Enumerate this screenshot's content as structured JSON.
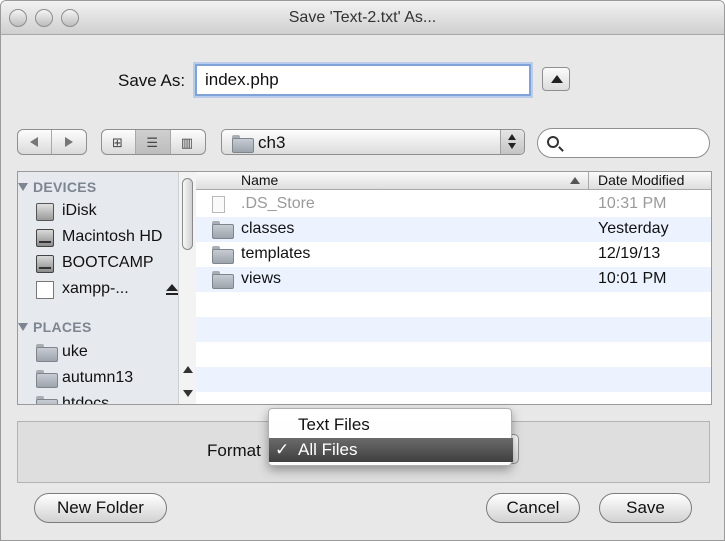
{
  "window": {
    "title": "Save 'Text-2.txt' As..."
  },
  "save_as": {
    "label": "Save As:",
    "value": "index.php"
  },
  "toolbar": {
    "path_label": "ch3",
    "search_value": ""
  },
  "sidebar": {
    "devices_header": "DEVICES",
    "devices": [
      {
        "label": "iDisk",
        "icon": "idisk-icon"
      },
      {
        "label": "Macintosh HD",
        "icon": "hard-drive-icon"
      },
      {
        "label": "BOOTCAMP",
        "icon": "hard-drive-icon"
      },
      {
        "label": "xampp-...",
        "icon": "volume-icon"
      }
    ],
    "places_header": "PLACES",
    "places": [
      {
        "label": "uke",
        "icon": "folder-icon"
      },
      {
        "label": "autumn13",
        "icon": "folder-icon"
      },
      {
        "label": "htdocs",
        "icon": "folder-icon"
      }
    ]
  },
  "file_list": {
    "columns": [
      "Name",
      "Date Modified"
    ],
    "rows": [
      {
        "name": ".DS_Store",
        "date": "10:31 PM",
        "icon": "document-icon",
        "dimmed": true
      },
      {
        "name": "classes",
        "date": "Yesterday",
        "icon": "folder-icon",
        "dimmed": false
      },
      {
        "name": "templates",
        "date": "12/19/13",
        "icon": "folder-icon",
        "dimmed": false
      },
      {
        "name": "views",
        "date": "10:01 PM",
        "icon": "folder-icon",
        "dimmed": false
      }
    ]
  },
  "format": {
    "label": "Format",
    "options": [
      "Text Files",
      "All Files"
    ],
    "selected": "All Files",
    "check": "✓"
  },
  "buttons": {
    "new_folder": "New Folder",
    "cancel": "Cancel",
    "save": "Save"
  },
  "colors": {
    "focus_ring": "#7fa3d6",
    "selected_menu": "#4f4f4f",
    "alt_row": "#edf3fe",
    "sidebar_bg": "#e6e9ee"
  }
}
